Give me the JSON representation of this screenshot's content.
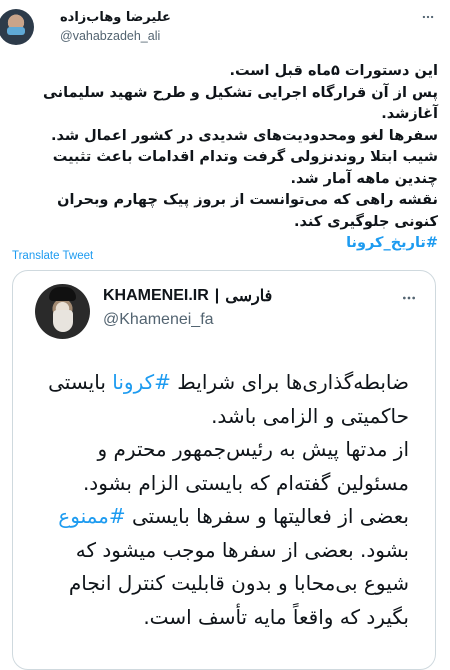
{
  "tweet": {
    "author": {
      "display_name": "علیرضا وهاب‌زاده",
      "handle": "@vahabzadeh_ali"
    },
    "body_lines": [
      "این دستورات ۵ماه قبل است.",
      "پس از آن قرارگاه اجرایی تشکیل و طرح شهید سلیمانی",
      "آغازشد.",
      "سفرها لغو ومحدودیت‌های شدیدی در کشور اعمال شد.",
      "شیب ابتلا روندنزولی گرفت وتدام اقدامات باعث تثبیت",
      "چندین ماهه آمار شد.",
      "نقشه راهی که می‌توانست از بروز پیک چهارم وبحران",
      "کنونی جلوگیری کند."
    ],
    "hashtag": "#تاریخ_کرونا",
    "translate_label": "Translate Tweet"
  },
  "quote": {
    "name_en": "KHAMENEI.IR",
    "name_separator": "|",
    "name_fa": "فارسی",
    "handle": "@Khamenei_fa",
    "lines": [
      {
        "parts": [
          {
            "t": "ضابطه‌گذاری‌ها برای شرایط ",
            "link": false
          },
          {
            "t": "#کرونا",
            "link": true
          },
          {
            "t": " بایستی",
            "link": false
          }
        ]
      },
      {
        "parts": [
          {
            "t": "حاکمیتی و الزامی باشد.",
            "link": false
          }
        ]
      },
      {
        "parts": [
          {
            "t": "از مدتها پیش به رئیس‌جمهور محترم و",
            "link": false
          }
        ]
      },
      {
        "parts": [
          {
            "t": "مسئولین گفته‌ام که بایستی الزام بشود.",
            "link": false
          }
        ]
      },
      {
        "parts": [
          {
            "t": "بعضی از فعالیتها و سفرها بایستی ",
            "link": false
          },
          {
            "t": "#ممنوع",
            "link": true
          }
        ]
      },
      {
        "parts": [
          {
            "t": "بشود. بعضی از سفرها موجب میشود که",
            "link": false
          }
        ]
      },
      {
        "parts": [
          {
            "t": "شیوع بی‌محابا و بدون قابلیت کنترل انجام",
            "link": false
          }
        ]
      },
      {
        "parts": [
          {
            "t": "بگیرد که واقعاً مایه تأسف است.",
            "link": false
          }
        ]
      }
    ]
  },
  "icons": {
    "more": "more-horizontal-icon"
  },
  "colors": {
    "link": "#1d9bf0",
    "text": "#0f1419",
    "secondary": "#536471",
    "border": "#cfd9de"
  }
}
